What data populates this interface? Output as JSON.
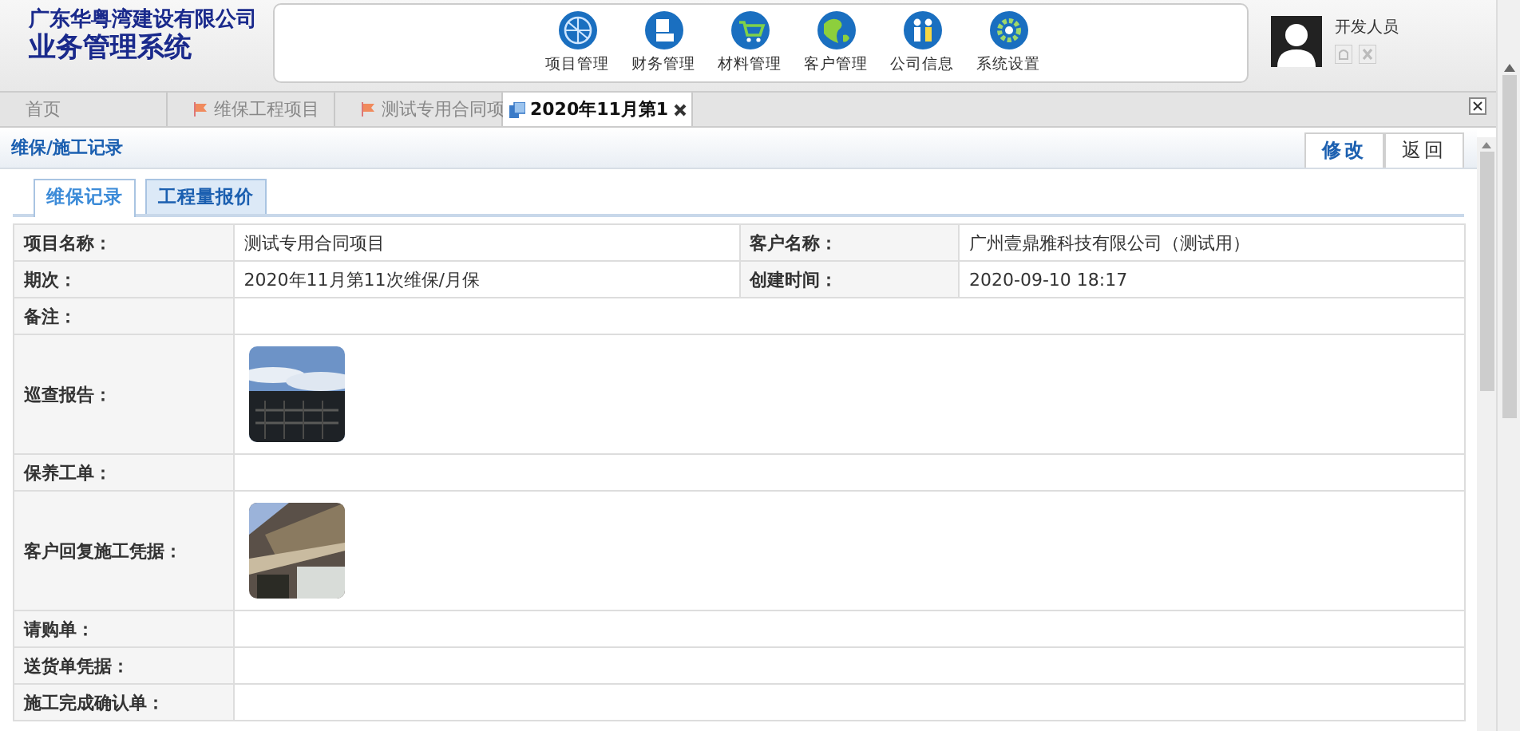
{
  "header": {
    "company": "广东华粤湾建设有限公司",
    "system": "业务管理系统",
    "nav": [
      {
        "label": "项目管理",
        "kind": "globe"
      },
      {
        "label": "财务管理",
        "kind": "card"
      },
      {
        "label": "材料管理",
        "kind": "cart"
      },
      {
        "label": "客户管理",
        "kind": "earth"
      },
      {
        "label": "公司信息",
        "kind": "people"
      },
      {
        "label": "系统设置",
        "kind": "gear"
      }
    ],
    "user": {
      "name": "开发人员"
    }
  },
  "tabs": [
    {
      "label": "首页",
      "kind": "plain",
      "selected": false
    },
    {
      "label": "维保工程项目",
      "kind": "flag",
      "selected": false
    },
    {
      "label": "测试专用合同项",
      "kind": "flag",
      "selected": false
    },
    {
      "label": "2020年11月第1",
      "kind": "doc",
      "selected": true
    }
  ],
  "page": {
    "title": "维保/施工记录",
    "buttons": [
      "修改",
      "返回"
    ]
  },
  "sub_tabs": [
    {
      "label": "维保记录",
      "selected": true
    },
    {
      "label": "工程量报价",
      "selected": false
    }
  ],
  "rows": [
    {
      "kind": "pair",
      "cells": [
        {
          "label": "项目名称：",
          "value": "测试专用合同项目"
        },
        {
          "label": "客户名称：",
          "value": "广州壹鼎雅科技有限公司（测试用）"
        }
      ]
    },
    {
      "kind": "pair",
      "cells": [
        {
          "label": "期次：",
          "value": "2020年11月第11次维保/月保"
        },
        {
          "label": "创建时间：",
          "value": "2020-09-10 18:17"
        }
      ]
    },
    {
      "kind": "text",
      "label": "备注："
    },
    {
      "kind": "photos",
      "label": "巡查报告："
    },
    {
      "kind": "text",
      "label": "保养工单："
    },
    {
      "kind": "photos",
      "label": "客户回复施工凭据："
    },
    {
      "kind": "text",
      "label": "请购单："
    },
    {
      "kind": "text",
      "label": "送货单凭据："
    },
    {
      "kind": "text",
      "label": "施工完成确认单："
    }
  ]
}
